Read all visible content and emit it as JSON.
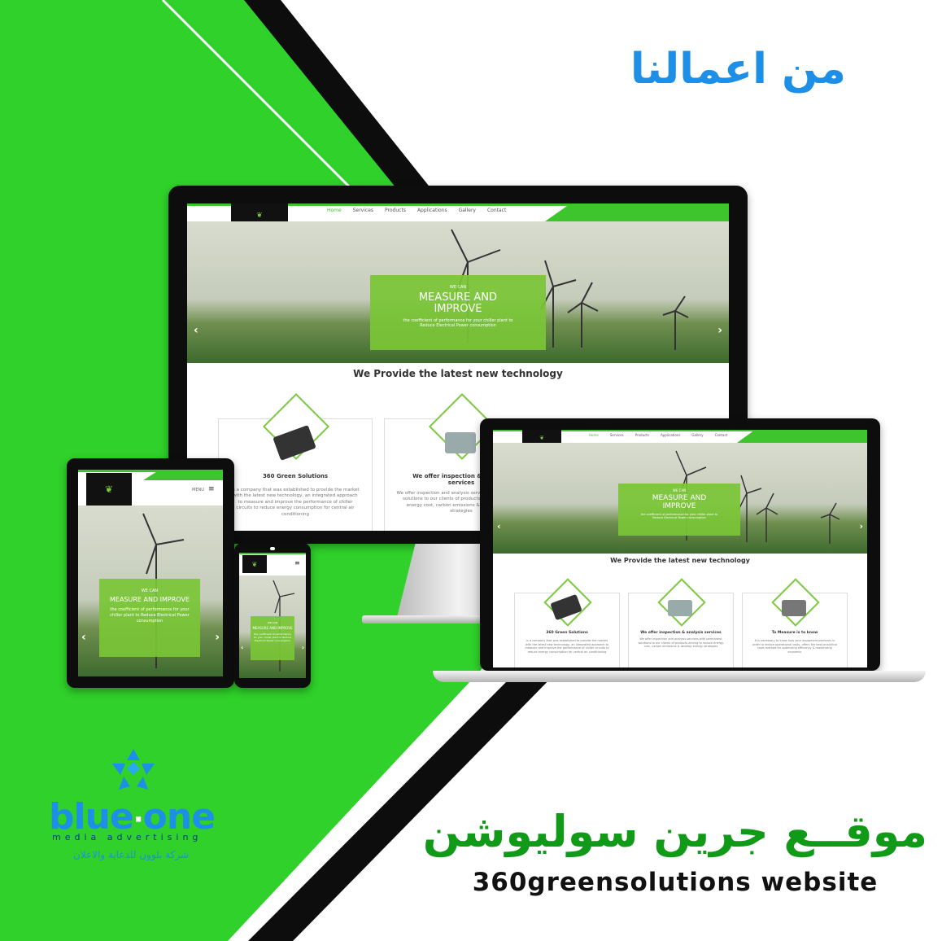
{
  "headline": "من اعمالنا",
  "project_title_ar": "موقــع جرين سوليوشن",
  "project_title_en": "360greensolutions website",
  "brand": {
    "name_part1": "blue",
    "name_part2": "one",
    "tagline": "media advertising",
    "tagline_ar": "شركة بلوون للدعاية والاعلان"
  },
  "colors": {
    "green": "#2fd12a",
    "black": "#0d0d0d",
    "blue": "#1e8fe6",
    "dark_green": "#109a18"
  },
  "website": {
    "nav": [
      "Home",
      "Services",
      "Products",
      "Applications",
      "Gallery",
      "Contact"
    ],
    "menu_label": "MENU",
    "hero_kicker": "WE CAN",
    "hero_title": "MEASURE AND IMPROVE",
    "hero_text": "the coefficient of performance for your chiller plant to Reduce Electrical Power consumption",
    "section_title": "We Provide the latest new technology",
    "cards": [
      {
        "title": "360 Green Solutions",
        "text": "is a company that was established to provide the market with the latest new technology, an integrated approach to measure and improve the performance of chiller circuits to reduce energy consumption for central air conditioning"
      },
      {
        "title": "We offer inspection & analysis services",
        "text": "We offer inspection and analysis services with permanent solutions to our clients of products aiming to reduce energy cost, carbon emissions & develop energy strategies"
      },
      {
        "title": "To Measure is to know",
        "text": "It is necessary to know how your equipment performs in order to reduce operational costs, offers the best analytical tools method for optimizing efficiency & maximizing economic"
      }
    ]
  }
}
